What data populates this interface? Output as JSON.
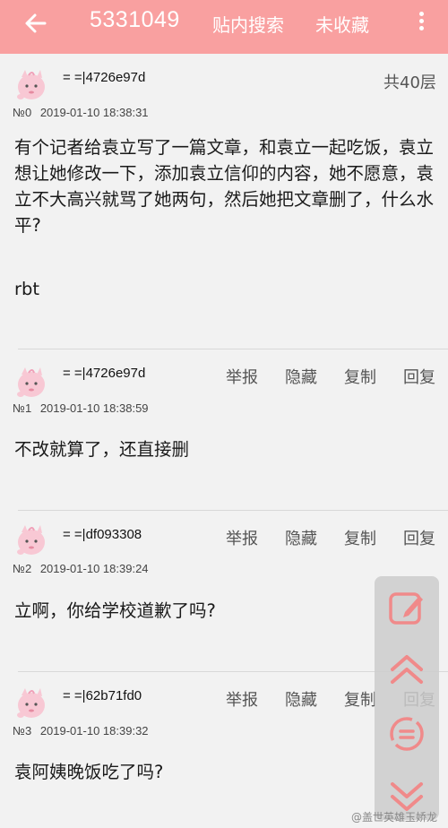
{
  "topbar": {
    "title": "5331049",
    "search_label": "贴内搜索",
    "favorite_label": "未收藏",
    "accent": "#f9a0a0"
  },
  "thread": {
    "floor_count": "共40层"
  },
  "posts": [
    {
      "username": "= =|4726e97d",
      "floor": "№0",
      "time": "2019-01-10 18:38:31",
      "content": "有个记者给袁立写了一篇文章，和袁立一起吃饭，袁立想让她修改一下，添加袁立信仰的内容，她不愿意，袁立不大高兴就骂了她两句，然后她把文章删了，什么水平?",
      "extra": "rbt"
    },
    {
      "username": "= =|4726e97d",
      "floor": "№1",
      "time": "2019-01-10 18:38:59",
      "content": "不改就算了，还直接删"
    },
    {
      "username": "= =|df093308",
      "floor": "№2",
      "time": "2019-01-10 18:39:24",
      "content": "立啊，你给学校道歉了吗?"
    },
    {
      "username": "= =|62b71fd0",
      "floor": "№3",
      "time": "2019-01-10 18:39:32",
      "content": "袁阿姨晚饭吃了吗?"
    }
  ],
  "actions": {
    "report": "举报",
    "hide": "隐藏",
    "copy": "复制",
    "reply": "回复"
  },
  "side_panel": {
    "icons": [
      "edit-icon",
      "scroll-up-icon",
      "refresh-icon",
      "scroll-down-icon"
    ],
    "icon_color": "#f08a8a"
  },
  "watermark": "@盖世英雄玉娇龙"
}
